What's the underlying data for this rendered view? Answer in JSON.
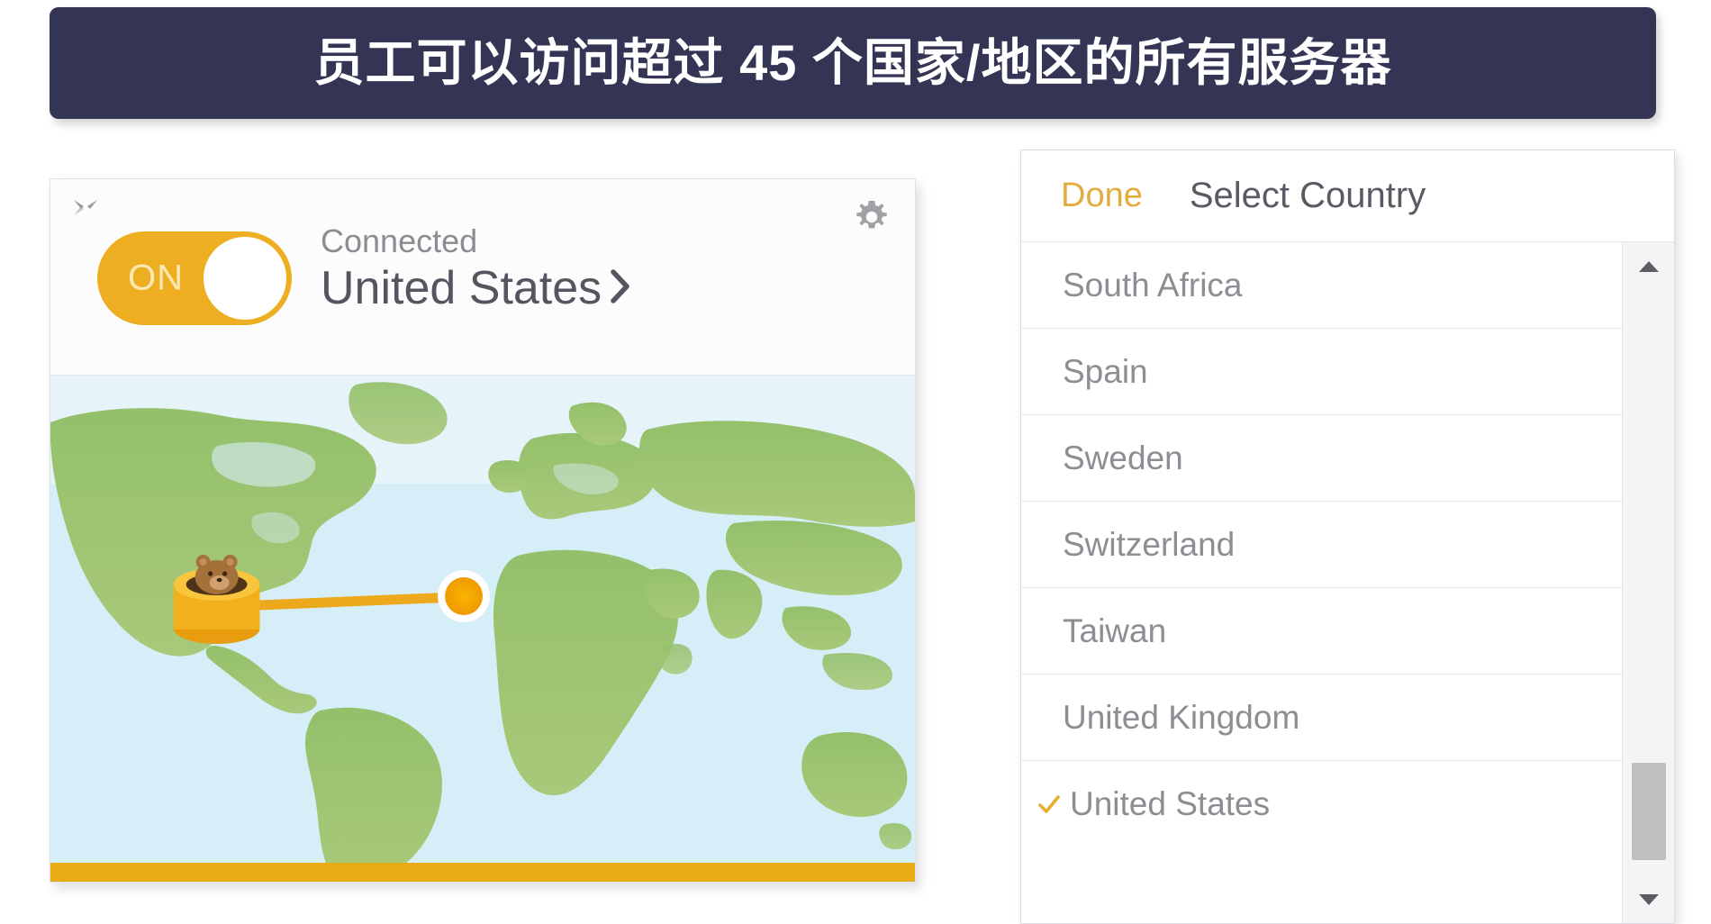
{
  "banner": {
    "text": "员工可以访问超过 45 个国家/地区的所有服务器",
    "background_color": "#343455",
    "text_color": "#ffffff"
  },
  "vpn_card": {
    "minimize_icon": "collapse-arrows-icon",
    "settings_icon": "gear-icon",
    "toggle": {
      "label": "ON",
      "state": "on",
      "track_color": "#edae21",
      "knob_color": "#ffffff",
      "label_color": "#fbe9b4"
    },
    "status_text": "Connected",
    "location_name": "United States",
    "location_chevron_icon": "chevron-right-icon",
    "map": {
      "ocean_color": "#d6eef7",
      "land_color": "#8cba63",
      "tunnel_color": "#f0b31c",
      "connection_line_color": "#eca91b",
      "destination_marker_color": "#f5a300",
      "bottom_bar_color": "#e8ab16"
    }
  },
  "country_panel": {
    "done_label": "Done",
    "done_color": "#e3ad3e",
    "title": "Select Country",
    "selected_country": "United States",
    "check_icon": "check-icon",
    "check_color": "#e8ae2b",
    "countries": [
      {
        "name": "South Africa",
        "selected": false
      },
      {
        "name": "Spain",
        "selected": false
      },
      {
        "name": "Sweden",
        "selected": false
      },
      {
        "name": "Switzerland",
        "selected": false
      },
      {
        "name": "Taiwan",
        "selected": false
      },
      {
        "name": "United Kingdom",
        "selected": false
      },
      {
        "name": "United States",
        "selected": true
      }
    ],
    "scrollbar": {
      "up_arrow_icon": "triangle-up-icon",
      "down_arrow_icon": "triangle-down-icon",
      "thumb_color": "#bfbfc2",
      "track_color": "#f4f4f6"
    }
  }
}
